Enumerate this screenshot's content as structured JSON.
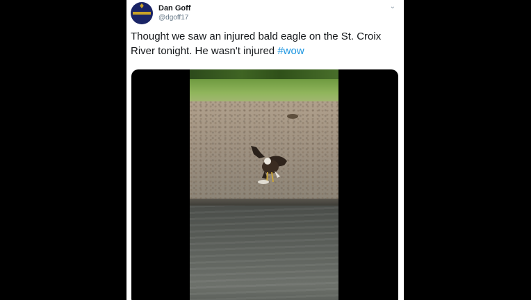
{
  "tweet": {
    "author": {
      "display_name": "Dan Goff",
      "handle": "@dgoff17"
    },
    "text": "Thought we saw an injured bald eagle on the St. Croix River tonight. He wasn't injured",
    "hashtag": "#wow",
    "menu_icon": "chevron-down-icon"
  },
  "media": {
    "type": "video",
    "subject": "bald-eagle-on-riverbank"
  },
  "colors": {
    "page_background": "#000000",
    "card_background": "#ffffff",
    "hashtag": "#1b95e0",
    "handle": "#657786",
    "avatar": "#1a2466"
  }
}
